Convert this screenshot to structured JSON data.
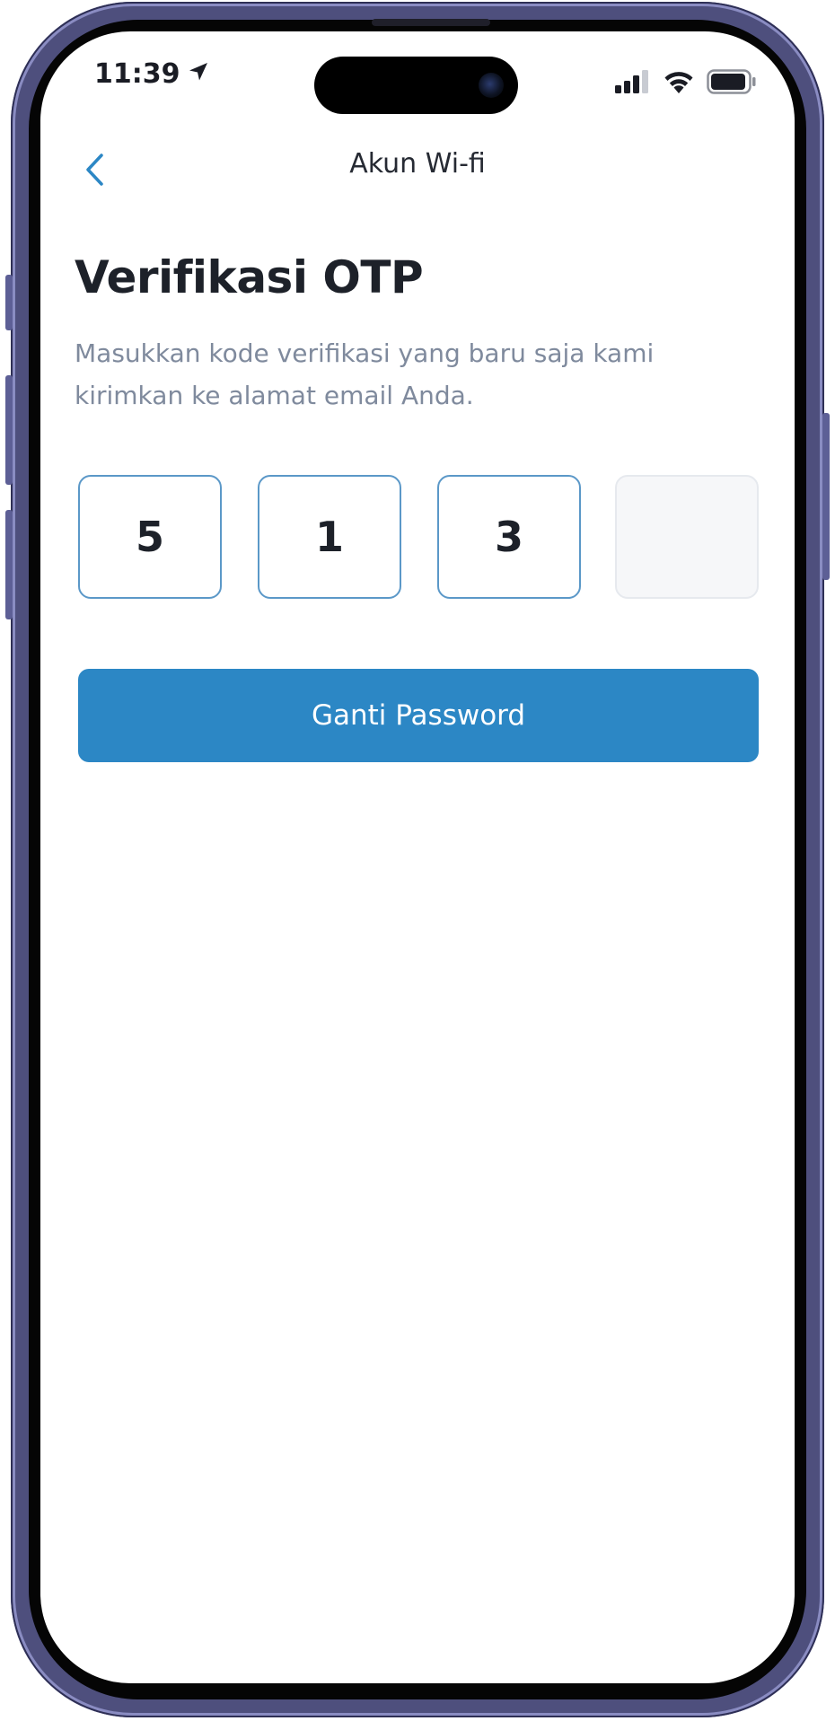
{
  "status_bar": {
    "time": "11:39",
    "icons": [
      "location-arrow-icon",
      "cellular-signal-icon",
      "wifi-icon",
      "battery-icon"
    ]
  },
  "nav": {
    "back_icon": "chevron-left-icon",
    "title": "Akun Wi-fi"
  },
  "main": {
    "heading": "Verifikasi OTP",
    "subtitle": "Masukkan kode verifikasi yang baru saja kami kirimkan ke alamat email Anda.",
    "otp_digits": [
      "5",
      "1",
      "3",
      ""
    ]
  },
  "actions": {
    "submit_label": "Ganti Password"
  },
  "colors": {
    "accent": "#2c87c5",
    "otp_border_active": "#5b98c8",
    "heading_text": "#1d2129",
    "subtitle_text": "#7f8a9d",
    "empty_box_bg": "#f6f7f9",
    "frame": "#4e4f7d"
  }
}
